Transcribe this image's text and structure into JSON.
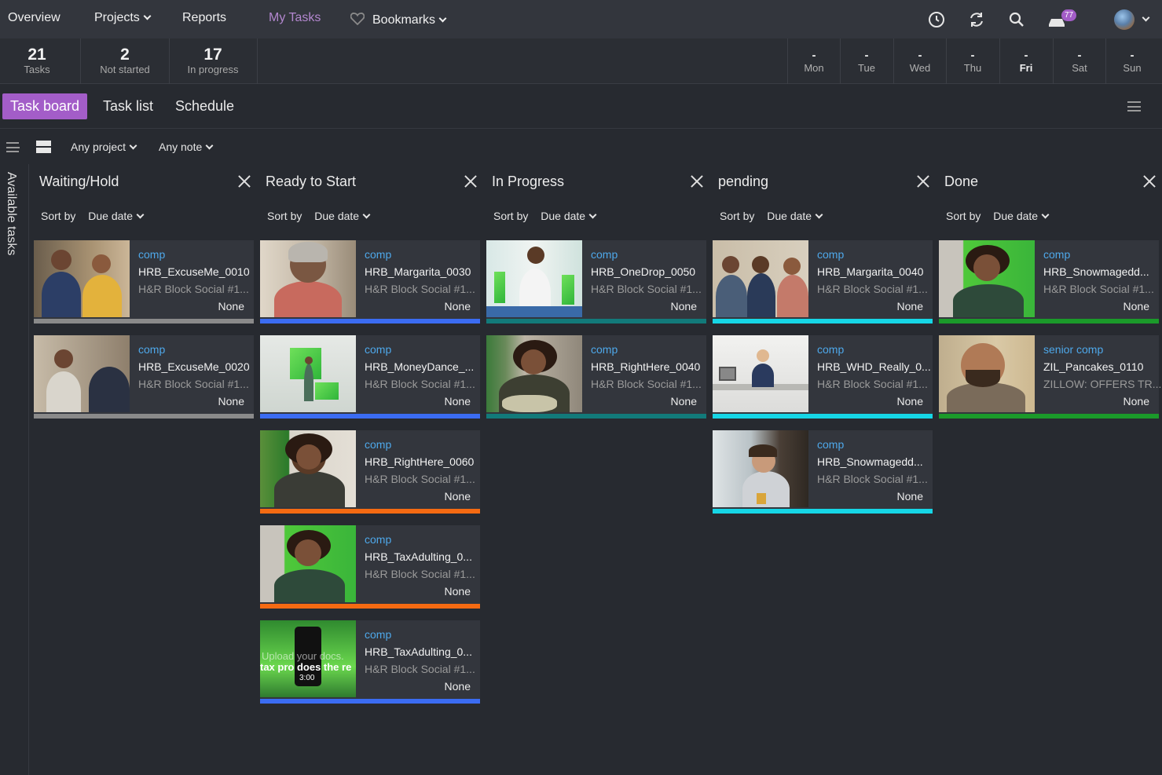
{
  "nav": {
    "overview": "Overview",
    "projects": "Projects",
    "reports": "Reports",
    "my_tasks": "My Tasks",
    "bookmarks": "Bookmarks",
    "notification_count": "77",
    "icons": [
      "clock-icon",
      "refresh-icon",
      "search-icon",
      "inbox-icon",
      "user-avatar"
    ]
  },
  "stats": [
    {
      "num": "21",
      "label": "Tasks"
    },
    {
      "num": "2",
      "label": "Not started"
    },
    {
      "num": "17",
      "label": "In progress"
    }
  ],
  "week": [
    {
      "dash": "-",
      "day": "Mon"
    },
    {
      "dash": "-",
      "day": "Tue"
    },
    {
      "dash": "-",
      "day": "Wed"
    },
    {
      "dash": "-",
      "day": "Thu"
    },
    {
      "dash": "-",
      "day": "Fri"
    },
    {
      "dash": "-",
      "day": "Sat"
    },
    {
      "dash": "-",
      "day": "Sun"
    }
  ],
  "views": {
    "task_board": "Task board",
    "task_list": "Task list",
    "schedule": "Schedule"
  },
  "filters": {
    "project": "Any project",
    "note": "Any note"
  },
  "sidebar_label": "Available tasks",
  "sort_label": "Sort by",
  "sort_value": "Due date",
  "colors": {
    "accent": "#a35dc8",
    "link": "#4ea8ea",
    "status_gray": "#8a8a8a",
    "status_blue": "#3b6cf2",
    "status_orange": "#f56a12",
    "status_teal": "#127a7a",
    "status_cyan": "#16d6e6",
    "status_green": "#1b9a2a"
  },
  "columns": [
    {
      "title": "Waiting/Hold",
      "cards": [
        {
          "tag": "comp",
          "name": "HRB_ExcuseMe_0010",
          "project": "H&R Block Social #1...",
          "due": "None",
          "bar": "#8a8a8a"
        },
        {
          "tag": "comp",
          "name": "HRB_ExcuseMe_0020",
          "project": "H&R Block Social #1...",
          "due": "None",
          "bar": "#8a8a8a"
        }
      ]
    },
    {
      "title": "Ready to Start",
      "cards": [
        {
          "tag": "comp",
          "name": "HRB_Margarita_0030",
          "project": "H&R Block Social #1...",
          "due": "None",
          "bar": "#3b6cf2"
        },
        {
          "tag": "comp",
          "name": "HRB_MoneyDance_...",
          "project": "H&R Block Social #1...",
          "due": "None",
          "bar": "#3b6cf2"
        },
        {
          "tag": "comp",
          "name": "HRB_RightHere_0060",
          "project": "H&R Block Social #1...",
          "due": "None",
          "bar": "#f56a12"
        },
        {
          "tag": "comp",
          "name": "HRB_TaxAdulting_0...",
          "project": "H&R Block Social #1...",
          "due": "None",
          "bar": "#f56a12"
        },
        {
          "tag": "comp",
          "name": "HRB_TaxAdulting_0...",
          "project": "H&R Block Social #1...",
          "due": "None",
          "bar": "#3b6cf2",
          "thumb_text": [
            "Upload your docs.",
            "tax pro does the re",
            "3:00"
          ]
        }
      ]
    },
    {
      "title": "In Progress",
      "cards": [
        {
          "tag": "comp",
          "name": "HRB_OneDrop_0050",
          "project": "H&R Block Social #1...",
          "due": "None",
          "bar": "#127a7a"
        },
        {
          "tag": "comp",
          "name": "HRB_RightHere_0040",
          "project": "H&R Block Social #1...",
          "due": "None",
          "bar": "#127a7a"
        }
      ]
    },
    {
      "title": "pending",
      "cards": [
        {
          "tag": "comp",
          "name": "HRB_Margarita_0040",
          "project": "H&R Block Social #1...",
          "due": "None",
          "bar": "#16d6e6"
        },
        {
          "tag": "comp",
          "name": "HRB_WHD_Really_0...",
          "project": "H&R Block Social #1...",
          "due": "None",
          "bar": "#16d6e6"
        },
        {
          "tag": "comp",
          "name": "HRB_Snowmagedd...",
          "project": "H&R Block Social #1...",
          "due": "None",
          "bar": "#16d6e6"
        }
      ]
    },
    {
      "title": "Done",
      "cards": [
        {
          "tag": "comp",
          "name": "HRB_Snowmagedd...",
          "project": "H&R Block Social #1...",
          "due": "None",
          "bar": "#1b9a2a"
        },
        {
          "tag": "senior comp",
          "name": "ZIL_Pancakes_0110",
          "project": "ZILLOW: OFFERS TR...",
          "due": "None",
          "bar": "#1b9a2a"
        }
      ]
    }
  ]
}
